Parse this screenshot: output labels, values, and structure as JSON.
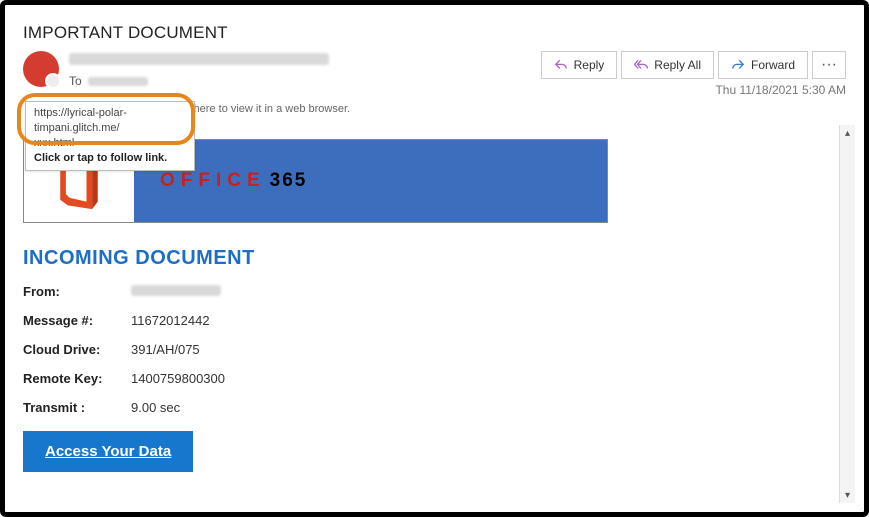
{
  "subject": "IMPORTANT DOCUMENT",
  "to_label": "To",
  "actions": {
    "reply": "Reply",
    "reply_all": "Reply All",
    "forward": "Forward",
    "more": "···"
  },
  "timestamp": "Thu 11/18/2021 5:30 AM",
  "infobar": "essage is displayed, click here to view it in a web browser.",
  "tooltip": {
    "line1": "https://lyrical-polar-timpani.glitch.me/",
    "line2": "xxx.html",
    "follow": "Click or tap to follow link."
  },
  "banner": {
    "word": "OFFICE",
    "num": "365"
  },
  "incoming_heading": "INCOMING DOCUMENT",
  "fields": {
    "from_label": "From:",
    "msg_label": "Message #:",
    "msg_val": "11672012442",
    "cloud_label": "Cloud Drive:",
    "cloud_val": "391/AH/075",
    "remote_label": "Remote Key:",
    "remote_val": "1400759800300",
    "transmit_label": "Transmit :",
    "transmit_val": "9.00 sec"
  },
  "access_button": "Access Your Data",
  "scroll": {
    "up": "▴",
    "down": "▾"
  }
}
